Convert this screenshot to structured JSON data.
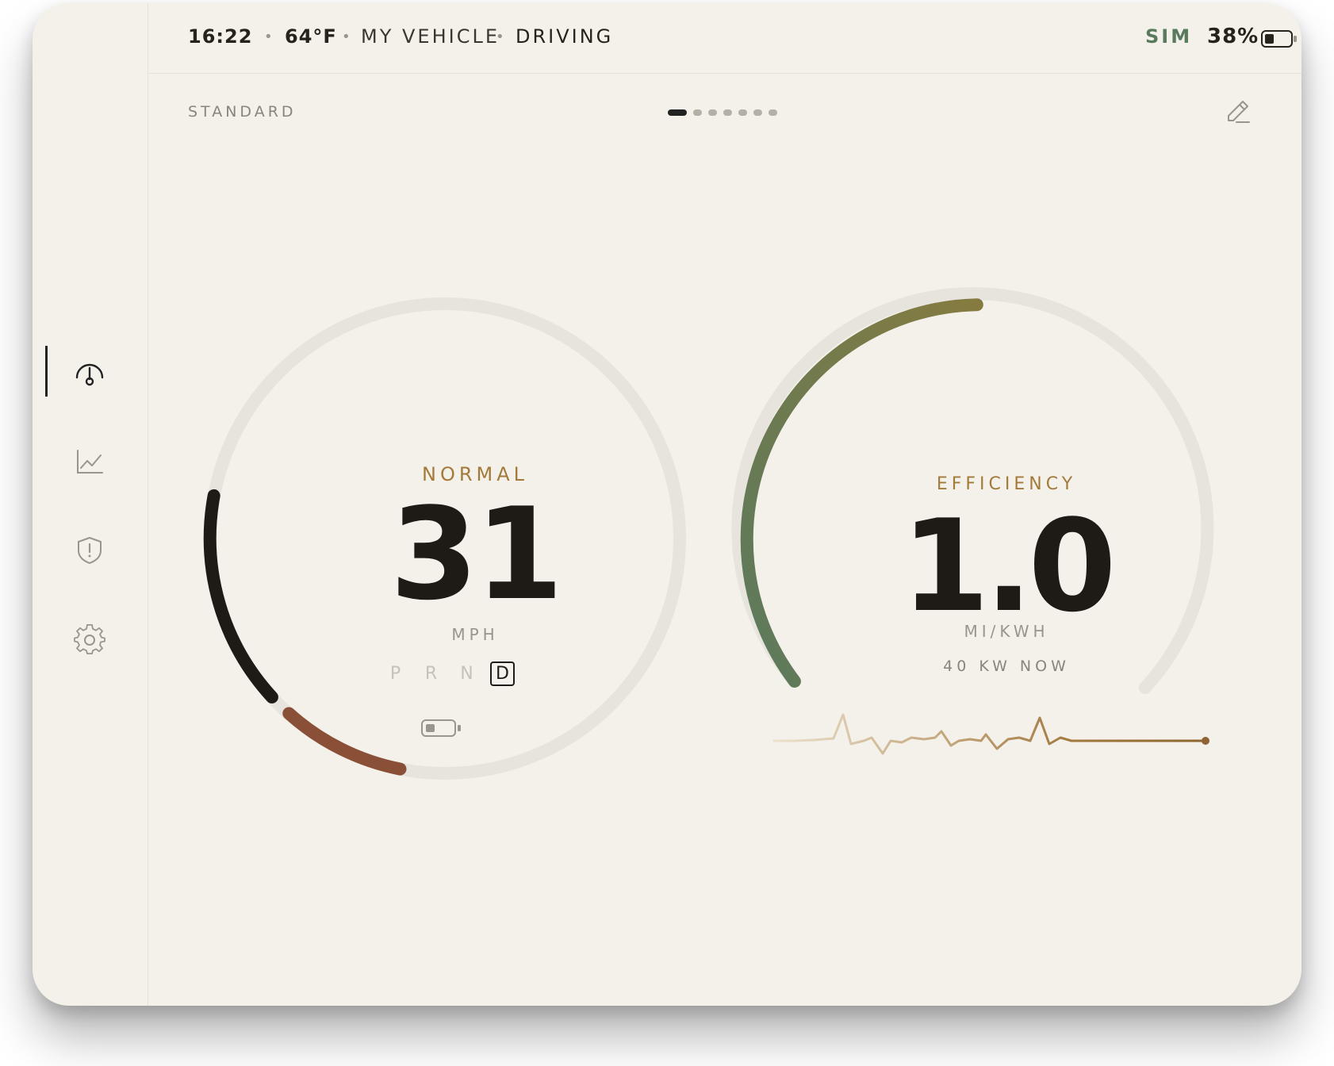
{
  "status": {
    "time": "16:22",
    "temperature": "64°F",
    "vehicle": "MY VEHICLE",
    "state": "DRIVING",
    "network": "SIM",
    "battery_percent": "38%",
    "battery_level": 0.38
  },
  "sidebar": {
    "items": [
      {
        "name": "dashboard",
        "icon": "gauge-icon",
        "active": true
      },
      {
        "name": "stats",
        "icon": "chart-line-icon",
        "active": false
      },
      {
        "name": "alerts",
        "icon": "shield-alert-icon",
        "active": false
      },
      {
        "name": "settings",
        "icon": "gear-icon",
        "active": false
      }
    ]
  },
  "layout": {
    "profile": "STANDARD",
    "page_count": 7,
    "active_page": 1
  },
  "speed": {
    "mode": "NORMAL",
    "value": "31",
    "unit": "MPH",
    "gears": [
      "P",
      "R",
      "N",
      "D"
    ],
    "active_gear": "D"
  },
  "efficiency": {
    "title": "EFFICIENCY",
    "value": "1.0",
    "unit": "MI/KWH",
    "power_now": "40 KW NOW"
  },
  "colors": {
    "background": "#f4f1eb",
    "speed_arc": "#1e1b17",
    "battery_arc": "#8a4f37",
    "efficiency_arc_start": "#5b7a5d",
    "efficiency_arc_end": "#857b40",
    "accent": "#a47a3a",
    "sim": "#5a7a5e"
  }
}
